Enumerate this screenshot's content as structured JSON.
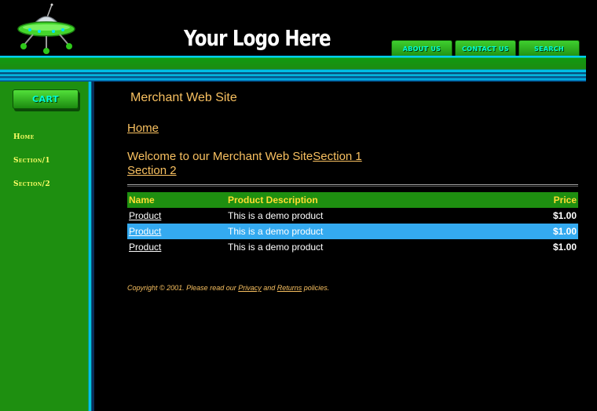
{
  "header": {
    "logo_text": "Your Logo Here",
    "nav": {
      "about": "ABOUT US",
      "contact": "CONTACT US",
      "search": "SEARCH"
    }
  },
  "sidebar": {
    "cart_label": "CART",
    "items": [
      {
        "label": "Home"
      },
      {
        "label": "Section/1"
      },
      {
        "label": "Section/2"
      }
    ]
  },
  "main": {
    "site_title": "Merchant Web Site",
    "breadcrumb_home": "Home",
    "welcome_text": "Welcome to our Merchant Web Site",
    "section_links": [
      "Section 1",
      "Section 2"
    ]
  },
  "products": {
    "headers": {
      "name": "Name",
      "description": "Product Description",
      "price": "Price"
    },
    "rows": [
      {
        "name": "Product",
        "description": "This is a demo product",
        "price": "$1.00"
      },
      {
        "name": "Product",
        "description": "This is a demo product",
        "price": "$1.00"
      },
      {
        "name": "Product",
        "description": "This is a demo product",
        "price": "$1.00"
      }
    ]
  },
  "footer": {
    "text_before": "Copyright © 2001. Please read our ",
    "privacy_link": "Privacy",
    "and_text": " and ",
    "returns_link": "Returns",
    "text_after": " policies."
  },
  "colors": {
    "background": "#000000",
    "sidebar_green": "#1e8f10",
    "accent_cyan": "#00e0ff",
    "link_orange": "#f8c060",
    "highlight_row": "#34aaf0",
    "header_text_yellow": "#ffdd33"
  },
  "icons": {
    "logo_graphic": "ufo-icon"
  }
}
